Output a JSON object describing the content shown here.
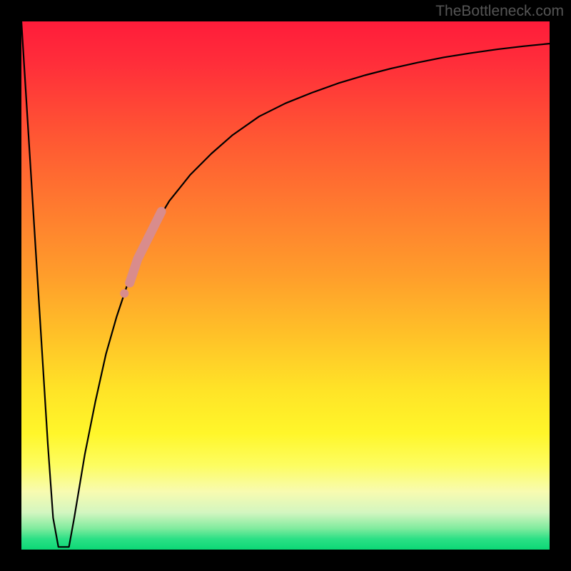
{
  "watermark": "TheBottleneck.com",
  "chart_data": {
    "type": "line",
    "title": "",
    "xlabel": "",
    "ylabel": "",
    "xlim": [
      0,
      100
    ],
    "ylim": [
      0,
      100
    ],
    "series": [
      {
        "name": "curve-left-descent",
        "x": [
          0,
          1,
          2,
          3,
          4,
          5,
          6,
          7
        ],
        "values": [
          100,
          84,
          68,
          52,
          36,
          20,
          6,
          0.5
        ]
      },
      {
        "name": "curve-valley",
        "x": [
          7,
          8,
          9
        ],
        "values": [
          0.5,
          0.5,
          0.5
        ]
      },
      {
        "name": "curve-right-rise",
        "x": [
          9,
          10,
          12,
          14,
          16,
          18,
          20,
          22,
          25,
          28,
          32,
          36,
          40,
          45,
          50,
          55,
          60,
          65,
          70,
          75,
          80,
          85,
          90,
          95,
          100
        ],
        "values": [
          0.5,
          6,
          18,
          28,
          37,
          44,
          50,
          55,
          61,
          66,
          71,
          75,
          78.5,
          82,
          84.5,
          86.5,
          88.3,
          89.8,
          91.1,
          92.2,
          93.2,
          94.0,
          94.7,
          95.3,
          95.8
        ]
      }
    ],
    "highlight_band": {
      "name": "pink-segment",
      "x": [
        19.5,
        20.5,
        22,
        23.5,
        25,
        26.5
      ],
      "values": [
        48.5,
        50.5,
        55,
        58,
        61,
        64
      ],
      "color": "#d98c8c"
    },
    "background_gradient": {
      "type": "vertical",
      "stops": [
        {
          "pos": 0.0,
          "color": "#ff1c3a"
        },
        {
          "pos": 0.22,
          "color": "#ff5733"
        },
        {
          "pos": 0.48,
          "color": "#ff9d2b"
        },
        {
          "pos": 0.7,
          "color": "#ffe427"
        },
        {
          "pos": 0.84,
          "color": "#fdfd60"
        },
        {
          "pos": 0.93,
          "color": "#d3f6c0"
        },
        {
          "pos": 1.0,
          "color": "#0cd876"
        }
      ]
    }
  }
}
